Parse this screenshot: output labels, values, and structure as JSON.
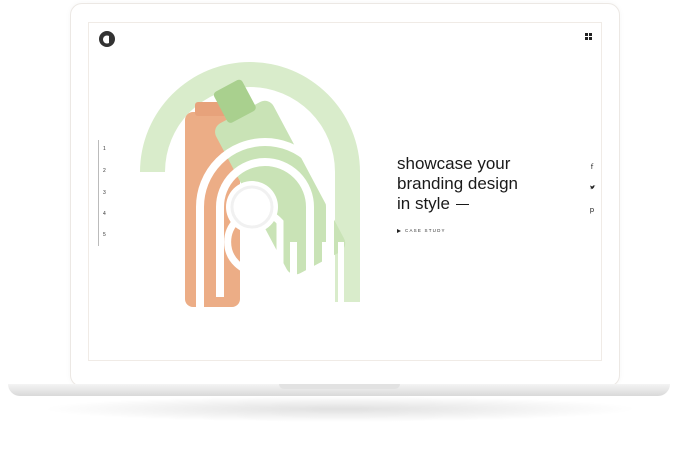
{
  "nav": {
    "items": [
      "1",
      "2",
      "3",
      "4",
      "5"
    ]
  },
  "hero": {
    "headline_lines": [
      "showcase your",
      "branding design",
      "in style"
    ],
    "cta_label": "CASE STUDY"
  },
  "social": {
    "facebook_glyph": "f",
    "twitter_glyph": "❦",
    "pinterest_glyph": "p"
  },
  "icons": {
    "logo": "brand-logo-icon",
    "menu": "grid-menu-icon",
    "facebook": "facebook-icon",
    "twitter": "twitter-icon",
    "pinterest": "pinterest-icon",
    "play": "play-icon"
  },
  "colors": {
    "accent_green": "#cfe8c0",
    "bottle_orange": "#ecad86",
    "bottle_green": "#bcdca8",
    "text": "#1a1a1a"
  }
}
